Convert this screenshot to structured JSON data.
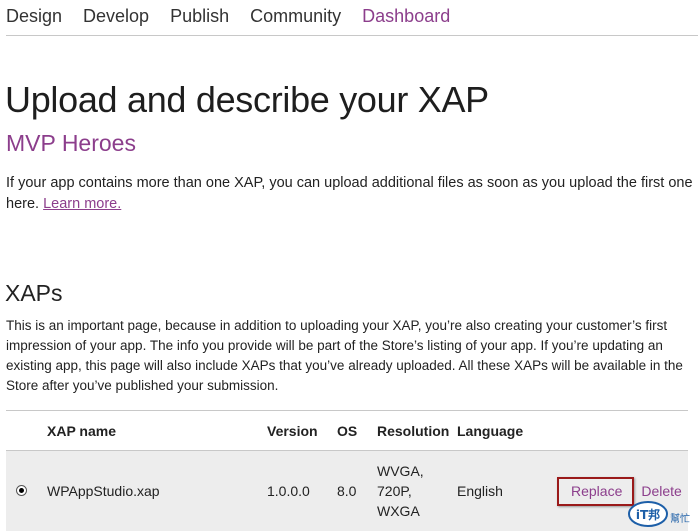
{
  "nav": {
    "items": [
      {
        "label": "Design"
      },
      {
        "label": "Develop"
      },
      {
        "label": "Publish"
      },
      {
        "label": "Community"
      },
      {
        "label": "Dashboard"
      }
    ]
  },
  "header": {
    "title": "Upload and describe your XAP",
    "app_name": "MVP Heroes"
  },
  "intro": {
    "text": "If your app contains more than one XAP, you can upload additional files as soon as you upload the first one here. ",
    "link": "Learn more."
  },
  "xaps": {
    "title": "XAPs",
    "description": "This is an important page, because in addition to uploading your XAP, you’re also creating your customer’s first impression of your app. The info you provide will be part of the Store’s listing of your app. If you’re updating an existing app, this page will also include XAPs that you’ve already uploaded. All these XAPs will be available in the Store after you’ve published your submission.",
    "columns": [
      "XAP name",
      "Version",
      "OS",
      "Resolution",
      "Language"
    ],
    "rows": [
      {
        "name": "WPAppStudio.xap",
        "version": "1.0.0.0",
        "os": "8.0",
        "resolution": [
          "WVGA,",
          "720P,",
          "WXGA"
        ],
        "language": "English",
        "replace_label": "Replace",
        "delete_label": "Delete"
      }
    ]
  },
  "watermark": {
    "text": "iT邦",
    "subtext": "幫忙"
  },
  "colors": {
    "accent": "#8c3e8c",
    "highlight_border": "#9a1a1a",
    "row_background": "#ededed"
  }
}
